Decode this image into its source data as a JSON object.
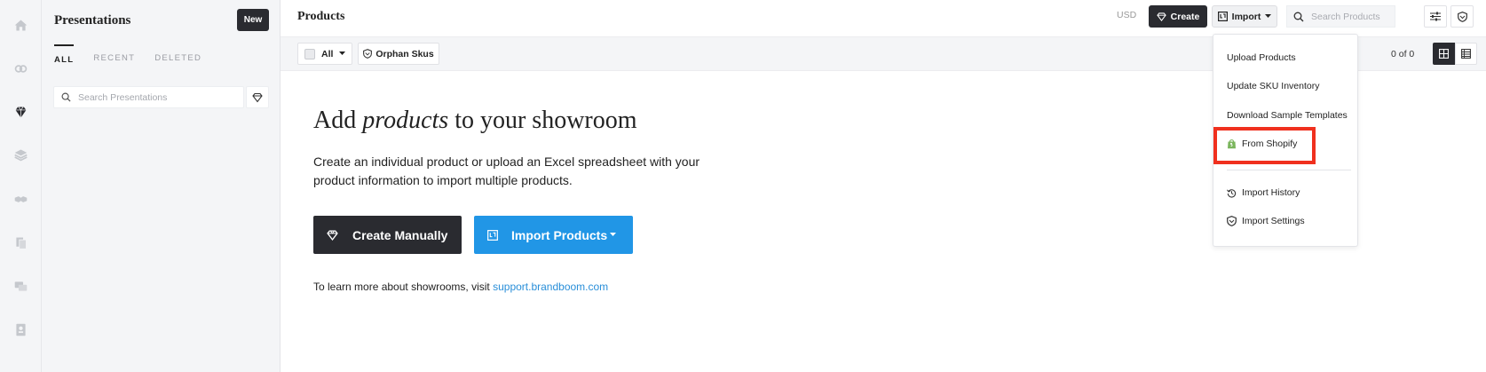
{
  "sidebar": {
    "title": "Presentations",
    "new_label": "New",
    "tabs": [
      {
        "label": "ALL",
        "active": true
      },
      {
        "label": "RECENT",
        "active": false
      },
      {
        "label": "DELETED",
        "active": false
      }
    ],
    "search_placeholder": "Search Presentations"
  },
  "header": {
    "title": "Products",
    "currency": "USD",
    "create_label": "Create",
    "import_label": "Import",
    "search_placeholder": "Search Products"
  },
  "filters": {
    "all_label": "All",
    "orphan_label": "Orphan Skus",
    "count": "0 of 0"
  },
  "main": {
    "title_pre": "Add ",
    "title_em": "products",
    "title_post": " to your showroom",
    "description": "Create an individual product or upload an Excel spreadsheet with your product information to import multiple products.",
    "create_manual_label": "Create Manually",
    "import_products_label": "Import Products",
    "learn_text": "To learn more about showrooms, visit ",
    "learn_link": "support.brandboom.com"
  },
  "import_menu": {
    "upload_products": "Upload Products",
    "update_sku": "Update SKU Inventory",
    "download_templates": "Download Sample Templates",
    "from_shopify": "From Shopify",
    "import_history": "Import History",
    "import_settings": "Import Settings"
  },
  "colors": {
    "dark": "#2a2b30",
    "primary_blue": "#2196e6",
    "link": "#2a8fd9",
    "highlight": "#f0301e",
    "shopify_green": "#7ab55c"
  }
}
